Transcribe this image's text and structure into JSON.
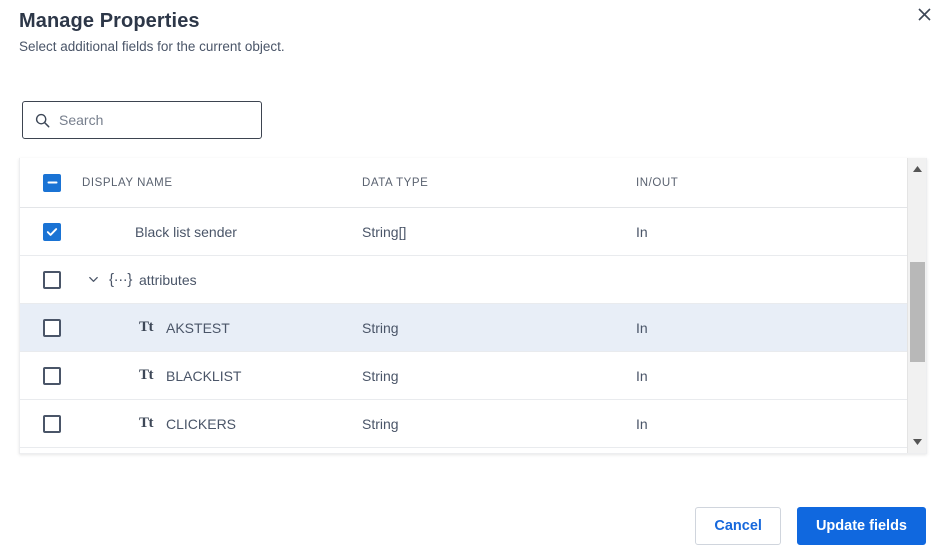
{
  "dialog": {
    "title": "Manage Properties",
    "subtitle": "Select additional fields for the current object.",
    "close_icon": "close-icon"
  },
  "search": {
    "placeholder": "Search",
    "value": "",
    "icon": "search-icon"
  },
  "table": {
    "select_all_state": "indeterminate",
    "columns": [
      {
        "key": "display_name",
        "label": "DISPLAY NAME"
      },
      {
        "key": "data_type",
        "label": "DATA TYPE"
      },
      {
        "key": "in_out",
        "label": "IN/OUT"
      }
    ],
    "rows": [
      {
        "display_name": "Black list sender",
        "data_type": "String[]",
        "in_out": "In",
        "checked": true,
        "level": 1,
        "icon": "none",
        "expandable": false,
        "highlighted": false
      },
      {
        "display_name": "attributes",
        "data_type": "",
        "in_out": "",
        "checked": false,
        "level": 0,
        "icon": "object-braces-icon",
        "expandable": true,
        "expanded": true,
        "highlighted": false
      },
      {
        "display_name": "AKSTEST",
        "data_type": "String",
        "in_out": "In",
        "checked": false,
        "level": 2,
        "icon": "text-type-icon",
        "expandable": false,
        "highlighted": true
      },
      {
        "display_name": "BLACKLIST",
        "data_type": "String",
        "in_out": "In",
        "checked": false,
        "level": 2,
        "icon": "text-type-icon",
        "expandable": false,
        "highlighted": false
      },
      {
        "display_name": "CLICKERS",
        "data_type": "String",
        "in_out": "In",
        "checked": false,
        "level": 2,
        "icon": "text-type-icon",
        "expandable": false,
        "highlighted": false
      }
    ],
    "object_icon_glyph": "{···}",
    "text_icon_glyph": "Tt"
  },
  "scrollbar": {
    "up_arrow_icon": "scroll-up-arrow-icon",
    "down_arrow_icon": "scroll-down-arrow-icon"
  },
  "footer": {
    "cancel_label": "Cancel",
    "update_label": "Update fields"
  },
  "colors": {
    "accent_blue": "#1068df",
    "checkbox_blue": "#1a73d4",
    "link_blue": "#1668dc",
    "row_highlight": "#e8eef7",
    "text_dark": "#2d3748",
    "text_muted": "#4a5568"
  }
}
